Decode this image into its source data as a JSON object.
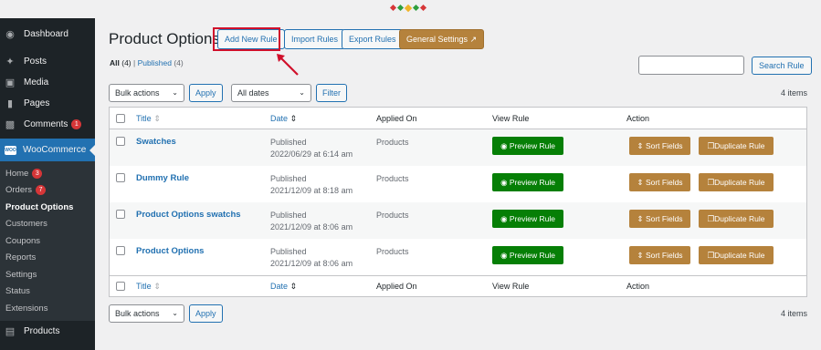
{
  "sidebar": {
    "dashboard": "Dashboard",
    "posts": "Posts",
    "media": "Media",
    "pages": "Pages",
    "comments": "Comments",
    "comments_badge": "1",
    "woocommerce": "WooCommerce",
    "woo_icon_text": "WOO",
    "submenu": {
      "home": "Home",
      "home_badge": "3",
      "orders": "Orders",
      "orders_badge": "7",
      "product_options": "Product Options",
      "customers": "Customers",
      "coupons": "Coupons",
      "reports": "Reports",
      "settings": "Settings",
      "status": "Status",
      "extensions": "Extensions"
    },
    "products": "Products"
  },
  "header": {
    "title": "Product Options",
    "add_new": "Add New Rule",
    "import": "Import Rules",
    "export": "Export Rules",
    "general": "General Settings",
    "highlight_color": "#d0102b"
  },
  "filters": {
    "all": "All",
    "all_count": "(4)",
    "separator": "|",
    "published": "Published",
    "published_count": "(4)",
    "search_button": "Search Rule",
    "bulk_actions": "Bulk actions",
    "apply": "Apply",
    "all_dates": "All dates",
    "filter": "Filter",
    "items_count": "4 items"
  },
  "table": {
    "columns": [
      "Title",
      "Date",
      "Applied On",
      "View Rule",
      "Action"
    ],
    "rows": [
      {
        "title": "Swatches",
        "status": "Published",
        "date": "2022/06/29 at 6:14 am",
        "applied_on": "Products"
      },
      {
        "title": "Dummy Rule",
        "status": "Published",
        "date": "2021/12/09 at 8:18 am",
        "applied_on": "Products"
      },
      {
        "title": "Product Options swatchs",
        "status": "Published",
        "date": "2021/12/09 at 8:06 am",
        "applied_on": "Products"
      },
      {
        "title": "Product Options",
        "status": "Published",
        "date": "2021/12/09 at 8:06 am",
        "applied_on": "Products"
      }
    ],
    "preview_label": "Preview Rule",
    "sort_label": "Sort Fields",
    "duplicate_label": "Duplicate Rule"
  },
  "colors": {
    "accent": "#2271b1",
    "sidebar_bg": "#1d2327",
    "green_btn": "#067f06",
    "brown_btn": "#b5823c",
    "badge": "#d63638"
  }
}
